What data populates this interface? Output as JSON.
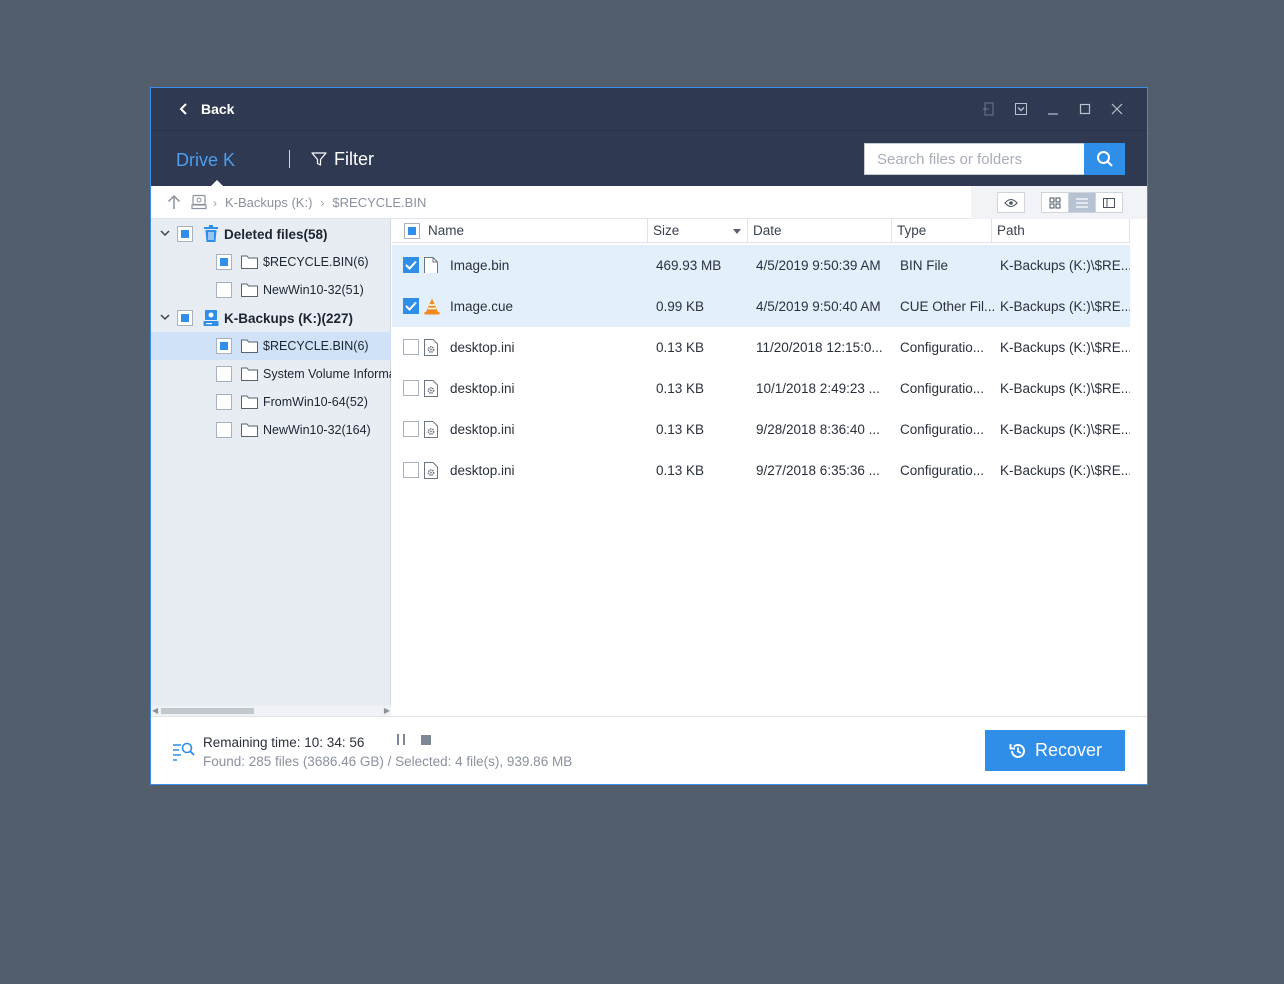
{
  "titlebar": {
    "back_label": "Back"
  },
  "nav": {
    "drive_tab": "Drive K",
    "filter_label": "Filter",
    "search_placeholder": "Search files or folders"
  },
  "path": {
    "crumbs": [
      "K-Backups (K:)",
      "$RECYCLE.BIN"
    ]
  },
  "sidebar": {
    "items": [
      {
        "label": "Deleted files(58)",
        "icon": "trash-icon",
        "type": "group",
        "check": "partial",
        "expanded": true
      },
      {
        "label": "$RECYCLE.BIN(6)",
        "icon": "folder-icon",
        "type": "child",
        "check": "partial"
      },
      {
        "label": "NewWin10-32(51)",
        "icon": "folder-icon",
        "type": "child",
        "check": "none"
      },
      {
        "label": "K-Backups (K:)(227)",
        "icon": "drive-icon",
        "type": "group",
        "check": "partial",
        "expanded": true
      },
      {
        "label": "$RECYCLE.BIN(6)",
        "icon": "folder-icon",
        "type": "child",
        "check": "partial",
        "selected": true
      },
      {
        "label": "System Volume Information",
        "icon": "folder-icon",
        "type": "child",
        "check": "none"
      },
      {
        "label": "FromWin10-64(52)",
        "icon": "folder-icon",
        "type": "child",
        "check": "none"
      },
      {
        "label": "NewWin10-32(164)",
        "icon": "folder-icon",
        "type": "child",
        "check": "none"
      }
    ]
  },
  "filelist": {
    "columns": {
      "name": "Name",
      "size": "Size",
      "date": "Date",
      "type": "Type",
      "path": "Path"
    },
    "rows": [
      {
        "name": "Image.bin",
        "size": "469.93 MB",
        "date": "4/5/2019 9:50:39 AM",
        "type": "BIN File",
        "path": "K-Backups (K:)\\$RE...",
        "icon": "file-icon",
        "checked": true
      },
      {
        "name": "Image.cue",
        "size": "0.99 KB",
        "date": "4/5/2019 9:50:40 AM",
        "type": "CUE Other Fil...",
        "path": "K-Backups (K:)\\$RE...",
        "icon": "vlc-cone-icon",
        "checked": true
      },
      {
        "name": "desktop.ini",
        "size": "0.13 KB",
        "date": "11/20/2018 12:15:0...",
        "type": "Configuratio...",
        "path": "K-Backups (K:)\\$RE...",
        "icon": "settings-file-icon",
        "checked": false
      },
      {
        "name": "desktop.ini",
        "size": "0.13 KB",
        "date": "10/1/2018 2:49:23 ...",
        "type": "Configuratio...",
        "path": "K-Backups (K:)\\$RE...",
        "icon": "settings-file-icon",
        "checked": false
      },
      {
        "name": "desktop.ini",
        "size": "0.13 KB",
        "date": "9/28/2018 8:36:40 ...",
        "type": "Configuratio...",
        "path": "K-Backups (K:)\\$RE...",
        "icon": "settings-file-icon",
        "checked": false
      },
      {
        "name": "desktop.ini",
        "size": "0.13 KB",
        "date": "9/27/2018 6:35:36 ...",
        "type": "Configuratio...",
        "path": "K-Backups (K:)\\$RE...",
        "icon": "settings-file-icon",
        "checked": false
      }
    ]
  },
  "status": {
    "remaining": "Remaining time: 10: 34: 56",
    "found": "Found: 285 files (3686.46 GB) / Selected: 4 file(s), 939.86 MB"
  },
  "actions": {
    "recover_label": "Recover"
  },
  "colors": {
    "accent": "#2e8ee8",
    "header_bg": "#2f3a52",
    "sidebar_bg": "#e8edf4",
    "desktop_bg": "#525e6c"
  }
}
